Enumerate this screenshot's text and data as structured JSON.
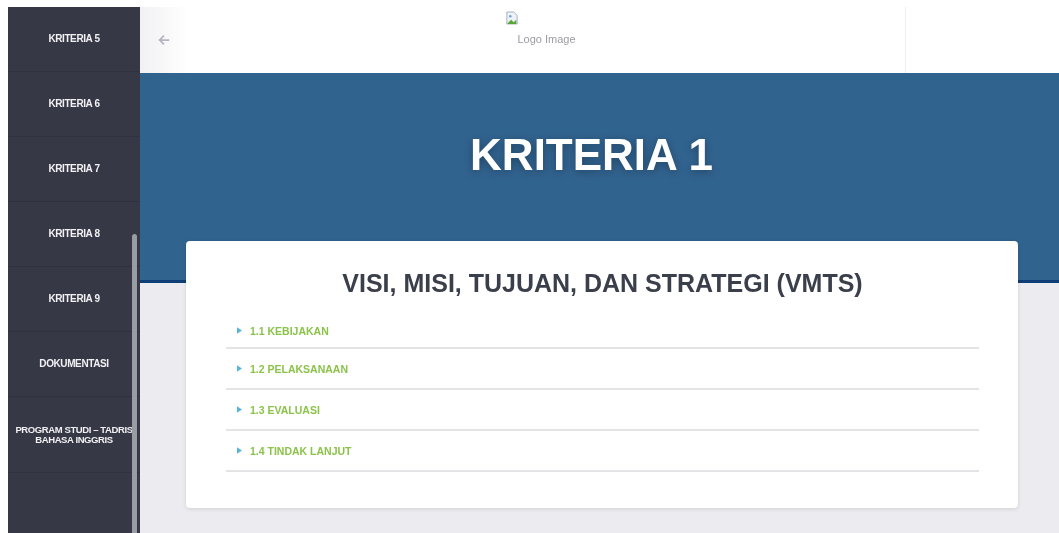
{
  "sidebar": {
    "items": [
      {
        "label": "KRITERIA 5"
      },
      {
        "label": "KRITERIA 6"
      },
      {
        "label": "KRITERIA 7"
      },
      {
        "label": "KRITERIA 8"
      },
      {
        "label": "KRITERIA 9"
      },
      {
        "label": "DOKUMENTASI"
      },
      {
        "label": "PROGRAM STUDI – TADRIS BAHASA INGGRIS"
      }
    ]
  },
  "header": {
    "logo": {
      "alt": "Logo Image"
    }
  },
  "hero": {
    "title": "KRITERIA 1"
  },
  "card": {
    "title": "VISI, MISI, TUJUAN, DAN STRATEGI (VMTS)",
    "sections": [
      {
        "label": "1.1 KEBIJAKAN",
        "expanded": false
      },
      {
        "label": "1.2 PELAKSANAAN",
        "expanded": false
      },
      {
        "label": "1.3 EVALUASI",
        "expanded": false
      },
      {
        "label": "1.4 TINDAK LANJUT",
        "expanded": false
      }
    ]
  }
}
